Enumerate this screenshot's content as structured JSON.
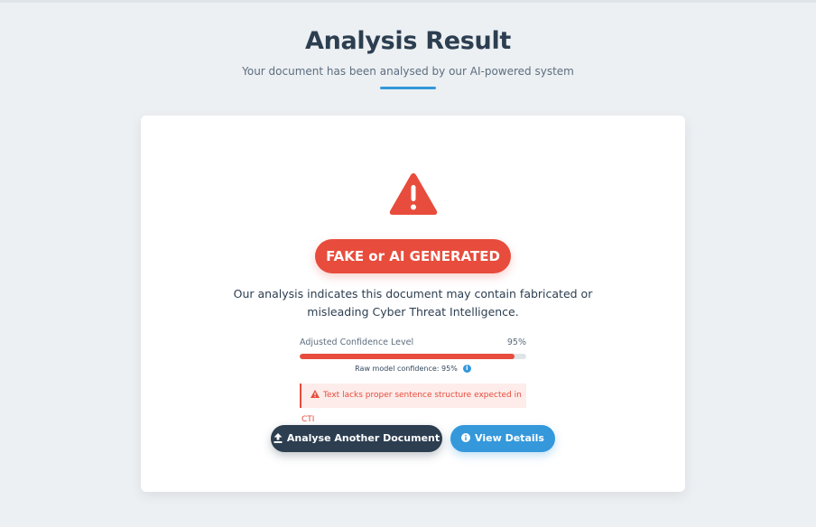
{
  "header": {
    "title": "Analysis Result",
    "subtitle": "Your document has been analysed by our AI-powered system"
  },
  "result": {
    "verdict": "FAKE or AI GENERATED",
    "description": "Our analysis indicates this document may contain fabricated or misleading Cyber Threat Intelligence.",
    "confidence_label": "Adjusted Confidence Level",
    "confidence_value": "95%",
    "confidence_fraction": 0.95,
    "raw_confidence": "Raw model confidence: 95%",
    "alert_text": "Text lacks proper sentence structure expected in CTI"
  },
  "actions": {
    "analyse_label": "Analyse Another Document",
    "details_label": "View Details"
  },
  "colors": {
    "danger": "#e74c3c",
    "primary": "#3498db",
    "dark": "#2c3e50"
  },
  "icons": {
    "verdict": "warning-triangle-icon",
    "analyse": "upload-icon",
    "details": "info-circle-icon"
  }
}
